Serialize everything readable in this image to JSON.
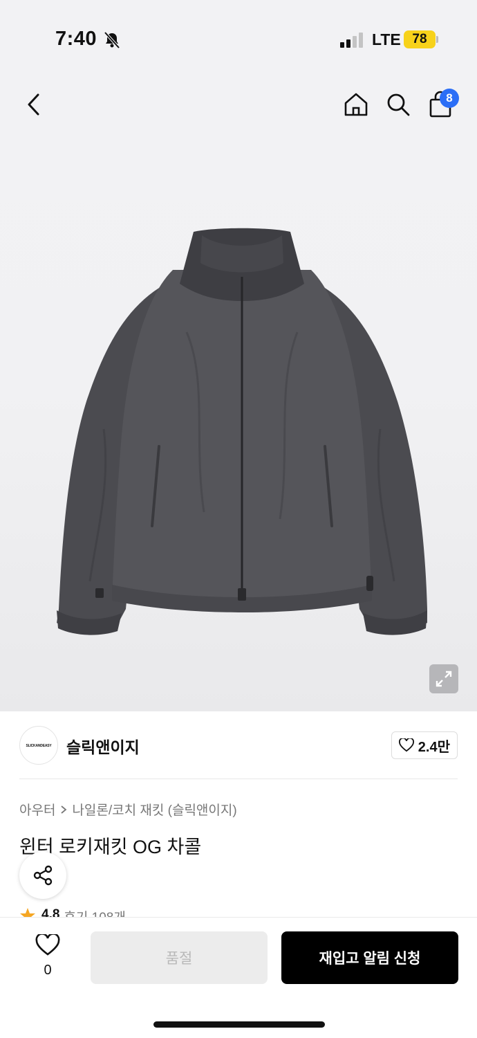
{
  "status": {
    "time": "7:40",
    "network": "LTE",
    "battery": "78"
  },
  "header": {
    "cart_count": "8"
  },
  "brand": {
    "logo_text": "SLICKANDEASY",
    "name": "슬릭앤이지",
    "likes": "2.4만"
  },
  "breadcrumb": [
    "아우터",
    "나일론/코치 재킷 (슬릭앤이지)"
  ],
  "product": {
    "title": "윈터 로키재킷 OG 차콜",
    "rating": "4.8",
    "reviews": "후기 108개"
  },
  "bottom": {
    "wish_count": "0",
    "soldout_label": "품절",
    "restock_label": "재입고 알림 신청"
  },
  "colors": {
    "accent_blue": "#2b6ef6",
    "battery_yellow": "#f7d21b",
    "star": "#f5a623"
  }
}
